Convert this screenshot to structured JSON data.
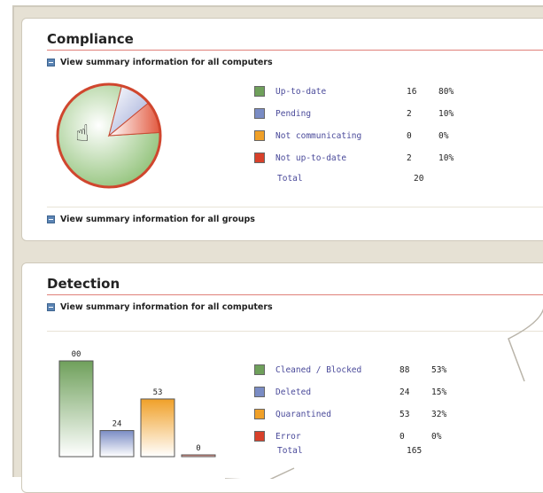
{
  "compliance": {
    "title": "Compliance",
    "link_computers": "View summary information for all computers",
    "link_groups": "View summary information for all groups",
    "legend": [
      {
        "label": "Up-to-date",
        "count": "16",
        "pct": "80%",
        "color": "#6fa05b"
      },
      {
        "label": "Pending",
        "count": "2",
        "pct": "10%",
        "color": "#7a8cc4"
      },
      {
        "label": "Not communicating",
        "count": "0",
        "pct": "0%",
        "color": "#f0a028"
      },
      {
        "label": "Not up-to-date",
        "count": "2",
        "pct": "10%",
        "color": "#d8402a"
      }
    ],
    "total_label": "Total",
    "total_value": "20"
  },
  "detection": {
    "title": "Detection",
    "link_computers": "View summary information for all computers",
    "legend": [
      {
        "label": "Cleaned / Blocked",
        "count": "88",
        "pct": "53%",
        "color": "#6fa05b"
      },
      {
        "label": "Deleted",
        "count": "24",
        "pct": "15%",
        "color": "#7a8cc4"
      },
      {
        "label": "Quarantined",
        "count": "53",
        "pct": "32%",
        "color": "#f0a028"
      },
      {
        "label": "Error",
        "count": "0",
        "pct": "0%",
        "color": "#d8402a"
      }
    ],
    "total_label": "Total",
    "total_value": "165"
  },
  "chart_data": [
    {
      "type": "pie",
      "categories": [
        "Up-to-date",
        "Pending",
        "Not communicating",
        "Not up-to-date"
      ],
      "values": [
        16,
        2,
        0,
        2
      ],
      "colors": [
        "#6fa05b",
        "#7a8cc4",
        "#f0a028",
        "#d8402a"
      ]
    },
    {
      "type": "bar",
      "categories": [
        "Cleaned / Blocked",
        "Deleted",
        "Quarantined",
        "Error"
      ],
      "values": [
        88,
        24,
        53,
        0
      ],
      "value_labels": [
        "00",
        "24",
        "53",
        "0"
      ],
      "colors": [
        "#6fa05b",
        "#7a8cc4",
        "#f0a028",
        "#d8402a"
      ]
    }
  ]
}
